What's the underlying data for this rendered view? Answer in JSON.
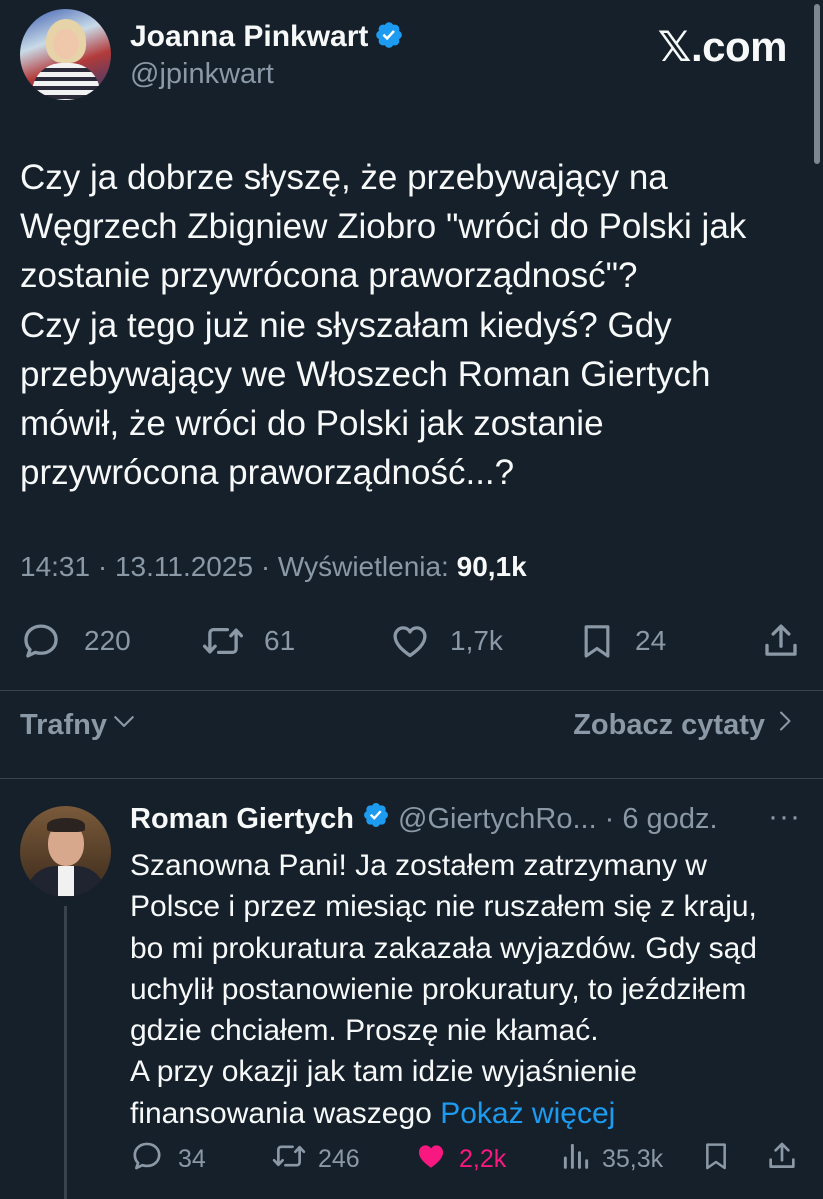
{
  "header": {
    "author_name": "Joanna Pinkwart",
    "author_handle": "@jpinkwart",
    "brand": "𝕏.com"
  },
  "tweet": {
    "text_lines": [
      "Czy ja dobrze słyszę, że przebywający na",
      "Węgrzech Zbigniew Ziobro \"wróci do Polski jak",
      "zostanie przywrócona praworządnosć\"?",
      "Czy ja tego już nie słyszałam kiedyś? Gdy",
      "przebywający we Włoszech Roman Giertych",
      "mówił, że wróci do Polski jak zostanie",
      "przywrócona praworządność...?"
    ],
    "time": "14:31",
    "date": "13.11.2025",
    "views_label": "Wyświetlenia:",
    "views_value": "90,1k",
    "separator": "·",
    "actions": {
      "replies": "220",
      "reposts": "61",
      "likes": "1,7k",
      "bookmarks": "24"
    }
  },
  "sort": {
    "left_label": "Trafny",
    "right_label": "Zobacz cytaty"
  },
  "reply": {
    "name": "Roman Giertych",
    "handle": "@GiertychRo...",
    "time": "· 6 godz.",
    "more": "···",
    "text_lines": [
      "Szanowna Pani! Ja zostałem zatrzymany w",
      "Polsce i przez miesiąc nie ruszałem się z kraju,",
      "bo mi prokuratura zakazała wyjazdów. Gdy sąd",
      "uchylił postanowienie prokuratury, to jeździłem",
      "gdzie chciałem. Proszę nie kłamać.",
      "A przy okazji jak tam idzie wyjaśnienie"
    ],
    "last_line": "finansowania waszego",
    "show_more": "Pokaż więcej",
    "actions": {
      "replies": "34",
      "reposts": "246",
      "likes": "2,2k",
      "views": "35,3k"
    }
  },
  "colors": {
    "background": "#15202b",
    "text": "#f7f9f9",
    "muted": "#8b98a5",
    "accent": "#1d9bf0",
    "like": "#f91880",
    "verified": "#1d9bf0"
  },
  "icons": [
    "verified-badge-icon",
    "reply-icon",
    "repost-icon",
    "like-icon",
    "bookmark-icon",
    "share-icon",
    "chevron-down-icon",
    "chevron-right-icon",
    "views-icon",
    "more-icon"
  ]
}
